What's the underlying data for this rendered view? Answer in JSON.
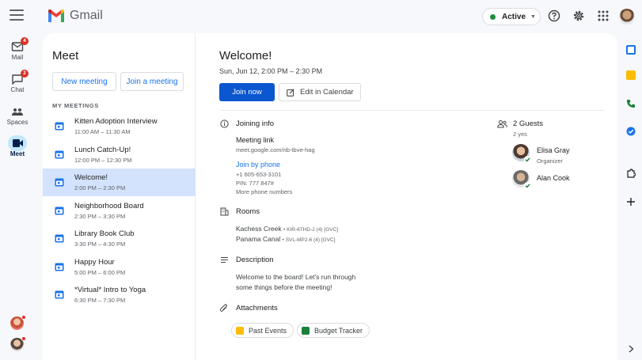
{
  "app": {
    "name": "Gmail"
  },
  "status": {
    "label": "Active",
    "color": "#1e8e3e"
  },
  "rail": {
    "items": [
      {
        "label": "Mail",
        "badge": "4"
      },
      {
        "label": "Chat",
        "badge": "2"
      },
      {
        "label": "Spaces"
      },
      {
        "label": "Meet"
      }
    ]
  },
  "meet": {
    "title": "Meet",
    "new_meeting": "New meeting",
    "join_meeting": "Join a meeting",
    "section_label": "MY MEETINGS",
    "meetings": [
      {
        "title": "Kitten Adoption Interview",
        "time": "11:00 AM – 11:30 AM"
      },
      {
        "title": "Lunch Catch-Up!",
        "time": "12:00 PM – 12:30 PM"
      },
      {
        "title": "Welcome!",
        "time": "2:00 PM – 2:30 PM"
      },
      {
        "title": "Neighborhood Board",
        "time": "2:30 PM – 3:30 PM"
      },
      {
        "title": "Library Book Club",
        "time": "3:30 PM – 4:30 PM"
      },
      {
        "title": "Happy Hour",
        "time": "5:00 PM – 6:00 PM"
      },
      {
        "title": "*Virtual* Intro to Yoga",
        "time": "6:30 PM – 7:30 PM"
      }
    ]
  },
  "detail": {
    "title": "Welcome!",
    "date": "Sun, Jun 12, 2:00 PM – 2:30 PM",
    "join_now": "Join now",
    "edit_calendar": "Edit in Calendar",
    "joining_info": {
      "heading": "Joining info",
      "meeting_link_label": "Meeting link",
      "meeting_link": "meet.google.com/rib-tbve-hag",
      "join_by_phone": "Join by phone",
      "phone": "+1 605-653-3101",
      "pin": "PIN: 777 847#",
      "more_numbers": "More phone numbers"
    },
    "rooms": {
      "heading": "Rooms",
      "items": [
        {
          "name": "Kachess Creek",
          "code": "• KIR-6THD-2 (4) [GVC]"
        },
        {
          "name": "Panama Canal",
          "code": "• SVL-MP2-6 (4) [GVC]"
        }
      ]
    },
    "description": {
      "heading": "Description",
      "line1": "Welcome to the board! Let's run through",
      "line2": "some things before the meeting!"
    },
    "attachments": {
      "heading": "Attachments",
      "items": [
        {
          "name": "Past Events",
          "color": "#fbbc04"
        },
        {
          "name": "Budget Tracker",
          "color": "#188038"
        }
      ]
    },
    "guests": {
      "heading": "2 Guests",
      "sub": "2 yes",
      "items": [
        {
          "name": "Elisa Gray",
          "role": "Organizer"
        },
        {
          "name": "Alan Cook",
          "role": ""
        }
      ]
    }
  },
  "colors": {
    "accent": "#0b57d0",
    "link": "#1a73e8",
    "selected": "#d3e3fd"
  }
}
